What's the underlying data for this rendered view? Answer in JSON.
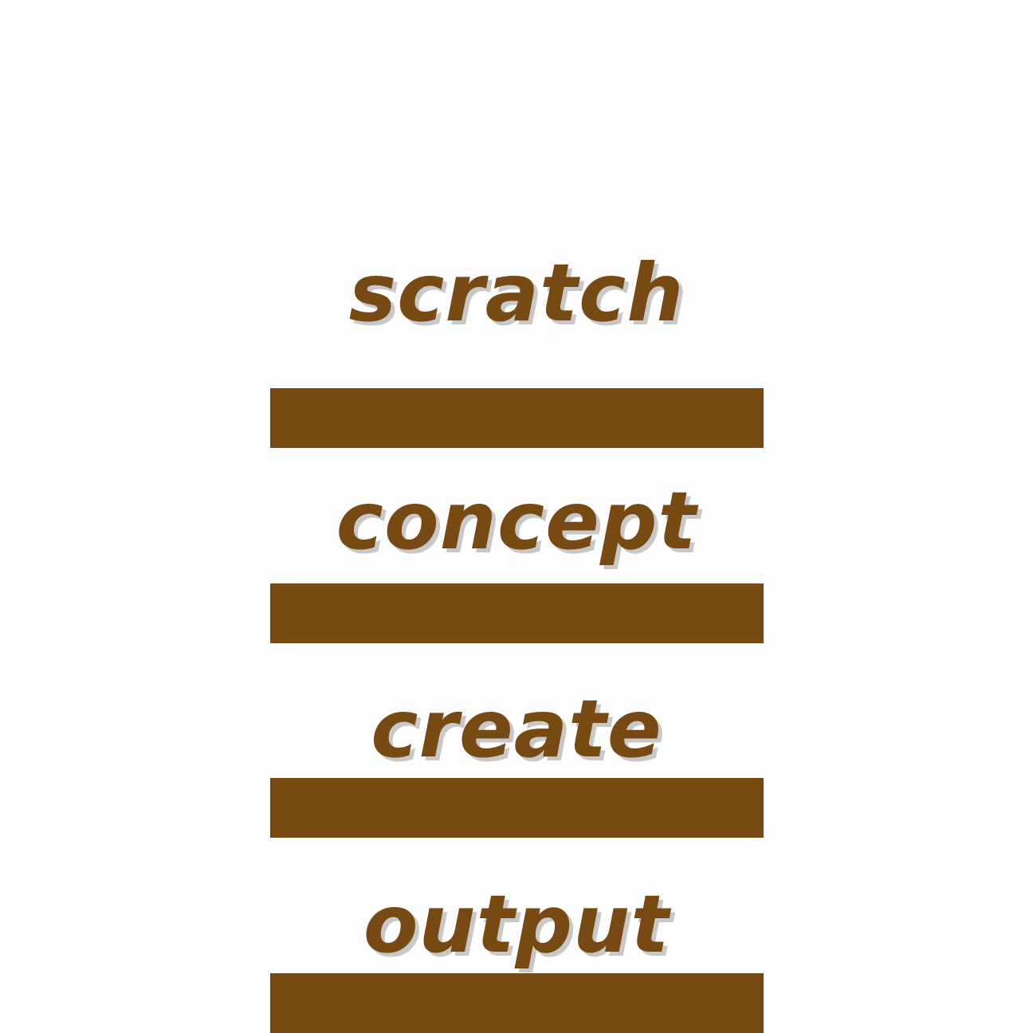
{
  "steps": [
    {
      "label": "scratch"
    },
    {
      "label": "concept"
    },
    {
      "label": "create"
    },
    {
      "label": "output"
    }
  ],
  "colors": {
    "accent": "#784a13",
    "shadow": "#c8c8c8",
    "background": "#fefefe"
  }
}
